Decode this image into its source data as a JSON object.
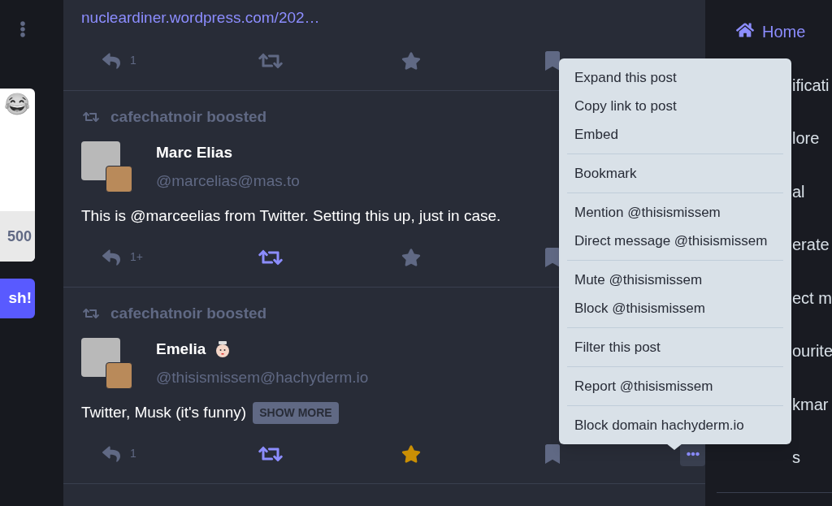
{
  "left_panel": {
    "card": {
      "emoji": "😂",
      "footer": "500"
    },
    "button": "sh!"
  },
  "posts": [
    {
      "link": "nucleardiner.wordpress.com/202…",
      "actions": {
        "reply_count": "1",
        "boosted": false,
        "favourited": false,
        "bookmarked": false,
        "menu_open": false
      }
    },
    {
      "boosted_by": "cafechatnoir boosted",
      "name": "Marc Elias",
      "handle": "@marcelias@mas.to",
      "text": "This is @marceelias from Twitter. Setting this up, just in case.",
      "actions": {
        "reply_count": "1+",
        "boosted": true,
        "favourited": false,
        "bookmarked": false,
        "menu_open": false
      }
    },
    {
      "boosted_by": "cafechatnoir boosted",
      "name": "Emelia",
      "handle": "@thisismissem@hachyderm.io",
      "text": "Twitter, Musk (it's funny)",
      "show_more": "SHOW MORE",
      "actions": {
        "reply_count": "1",
        "boosted": true,
        "favourited": true,
        "bookmarked": false,
        "menu_open": true
      }
    }
  ],
  "menu": {
    "groups": [
      [
        "Expand this post",
        "Copy link to post",
        "Embed"
      ],
      [
        "Bookmark"
      ],
      [
        "Mention @thisismissem",
        "Direct message @thisismissem"
      ],
      [
        "Mute @thisismissem",
        "Block @thisismissem"
      ],
      [
        "Filter this post"
      ],
      [
        "Report @thisismissem"
      ],
      [
        "Block domain hachyderm.io"
      ]
    ]
  },
  "nav": [
    {
      "label": "Home",
      "selected": true
    },
    {
      "label": "ificati",
      "selected": false
    },
    {
      "label": "lore",
      "selected": false
    },
    {
      "label": "al",
      "selected": false
    },
    {
      "label": "erate",
      "selected": false
    },
    {
      "label": "ect m",
      "selected": false
    },
    {
      "label": "ourite",
      "selected": false
    },
    {
      "label": "kmar",
      "selected": false
    },
    {
      "label": "s",
      "selected": false
    }
  ]
}
